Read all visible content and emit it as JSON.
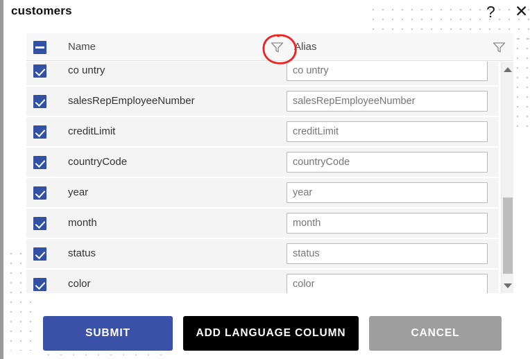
{
  "window": {
    "title": "customers",
    "help_icon": "?",
    "close_icon": "✕"
  },
  "table": {
    "header": {
      "select_all_state": "indeterminate",
      "name_label": "Name",
      "alias_label": "Alias",
      "name_filter_icon": "filter-funnel-icon",
      "alias_filter_icon": "filter-funnel-icon"
    },
    "rows": [
      {
        "checked": true,
        "name": "co untry",
        "alias": "co untry"
      },
      {
        "checked": true,
        "name": "salesRepEmployeeNumber",
        "alias": "salesRepEmployeeNumber"
      },
      {
        "checked": true,
        "name": "creditLimit",
        "alias": "creditLimit"
      },
      {
        "checked": true,
        "name": "countryCode",
        "alias": "countryCode"
      },
      {
        "checked": true,
        "name": "year",
        "alias": "year"
      },
      {
        "checked": true,
        "name": "month",
        "alias": "month"
      },
      {
        "checked": true,
        "name": "status",
        "alias": "status"
      },
      {
        "checked": true,
        "name": "color",
        "alias": "color"
      }
    ],
    "scrollbar": {
      "up_arrow": "scroll-up-arrow",
      "down_arrow": "scroll-down-arrow"
    }
  },
  "annotation": {
    "shape": "red-hand-drawn-circle",
    "color": "#ef2020",
    "target": "name-column-filter-icon"
  },
  "footer": {
    "submit_label": "SUBMIT",
    "add_language_column_label": "ADD LANGUAGE COLUMN",
    "cancel_label": "CANCEL"
  },
  "colors": {
    "accent_blue": "#3b51a8",
    "checkbox_blue": "#3351a3",
    "black_button": "#000000",
    "cancel_gray": "#9e9e9e",
    "row_bg": "#f4f4f4",
    "header_bg": "#f7f7f7",
    "annotation_red": "#ef2020"
  }
}
